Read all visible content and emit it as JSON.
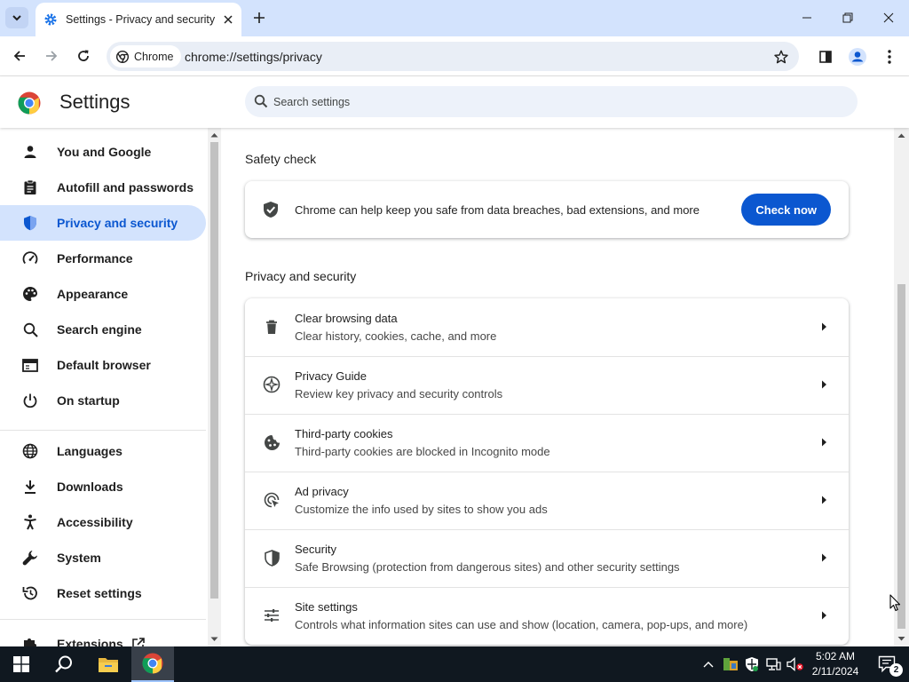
{
  "window": {
    "tab_title": "Settings - Privacy and security",
    "new_tab_label": "+",
    "minimize_label": "Minimize",
    "maximize_label": "Restore",
    "close_label": "Close"
  },
  "toolbar": {
    "chip_label": "Chrome",
    "url": "chrome://settings/privacy"
  },
  "header": {
    "title": "Settings",
    "search_placeholder": "Search settings"
  },
  "sidebar": {
    "items": [
      {
        "label": "You and Google",
        "icon": "person-icon",
        "active": false
      },
      {
        "label": "Autofill and passwords",
        "icon": "clipboard-icon",
        "active": false
      },
      {
        "label": "Privacy and security",
        "icon": "shield-icon",
        "active": true
      },
      {
        "label": "Performance",
        "icon": "speedometer-icon",
        "active": false
      },
      {
        "label": "Appearance",
        "icon": "palette-icon",
        "active": false
      },
      {
        "label": "Search engine",
        "icon": "search-icon",
        "active": false
      },
      {
        "label": "Default browser",
        "icon": "browser-icon",
        "active": false
      },
      {
        "label": "On startup",
        "icon": "power-icon",
        "active": false
      },
      {
        "label": "Languages",
        "icon": "globe-icon",
        "active": false
      },
      {
        "label": "Downloads",
        "icon": "download-icon",
        "active": false
      },
      {
        "label": "Accessibility",
        "icon": "accessibility-icon",
        "active": false
      },
      {
        "label": "System",
        "icon": "wrench-icon",
        "active": false
      },
      {
        "label": "Reset settings",
        "icon": "reset-icon",
        "active": false
      },
      {
        "label": "Extensions",
        "icon": "puzzle-icon",
        "active": false
      }
    ]
  },
  "main": {
    "safety_check": {
      "title": "Safety check",
      "text": "Chrome can help keep you safe from data breaches, bad extensions, and more",
      "button": "Check now"
    },
    "privacy": {
      "title": "Privacy and security",
      "rows": [
        {
          "title": "Clear browsing data",
          "subtitle": "Clear history, cookies, cache, and more",
          "icon": "trash-icon"
        },
        {
          "title": "Privacy Guide",
          "subtitle": "Review key privacy and security controls",
          "icon": "compass-icon"
        },
        {
          "title": "Third-party cookies",
          "subtitle": "Third-party cookies are blocked in Incognito mode",
          "icon": "cookie-icon"
        },
        {
          "title": "Ad privacy",
          "subtitle": "Customize the info used by sites to show you ads",
          "icon": "ad-privacy-icon"
        },
        {
          "title": "Security",
          "subtitle": "Safe Browsing (protection from dangerous sites) and other security settings",
          "icon": "shield-outline-icon"
        },
        {
          "title": "Site settings",
          "subtitle": "Controls what information sites can use and show (location, camera, pop-ups, and more)",
          "icon": "sliders-icon"
        }
      ]
    }
  },
  "taskbar": {
    "time": "5:02 AM",
    "date": "2/11/2024",
    "notification_count": "2"
  },
  "colors": {
    "accent": "#0b57d0",
    "active_bg": "#d3e3fd",
    "taskbar": "#101820"
  }
}
